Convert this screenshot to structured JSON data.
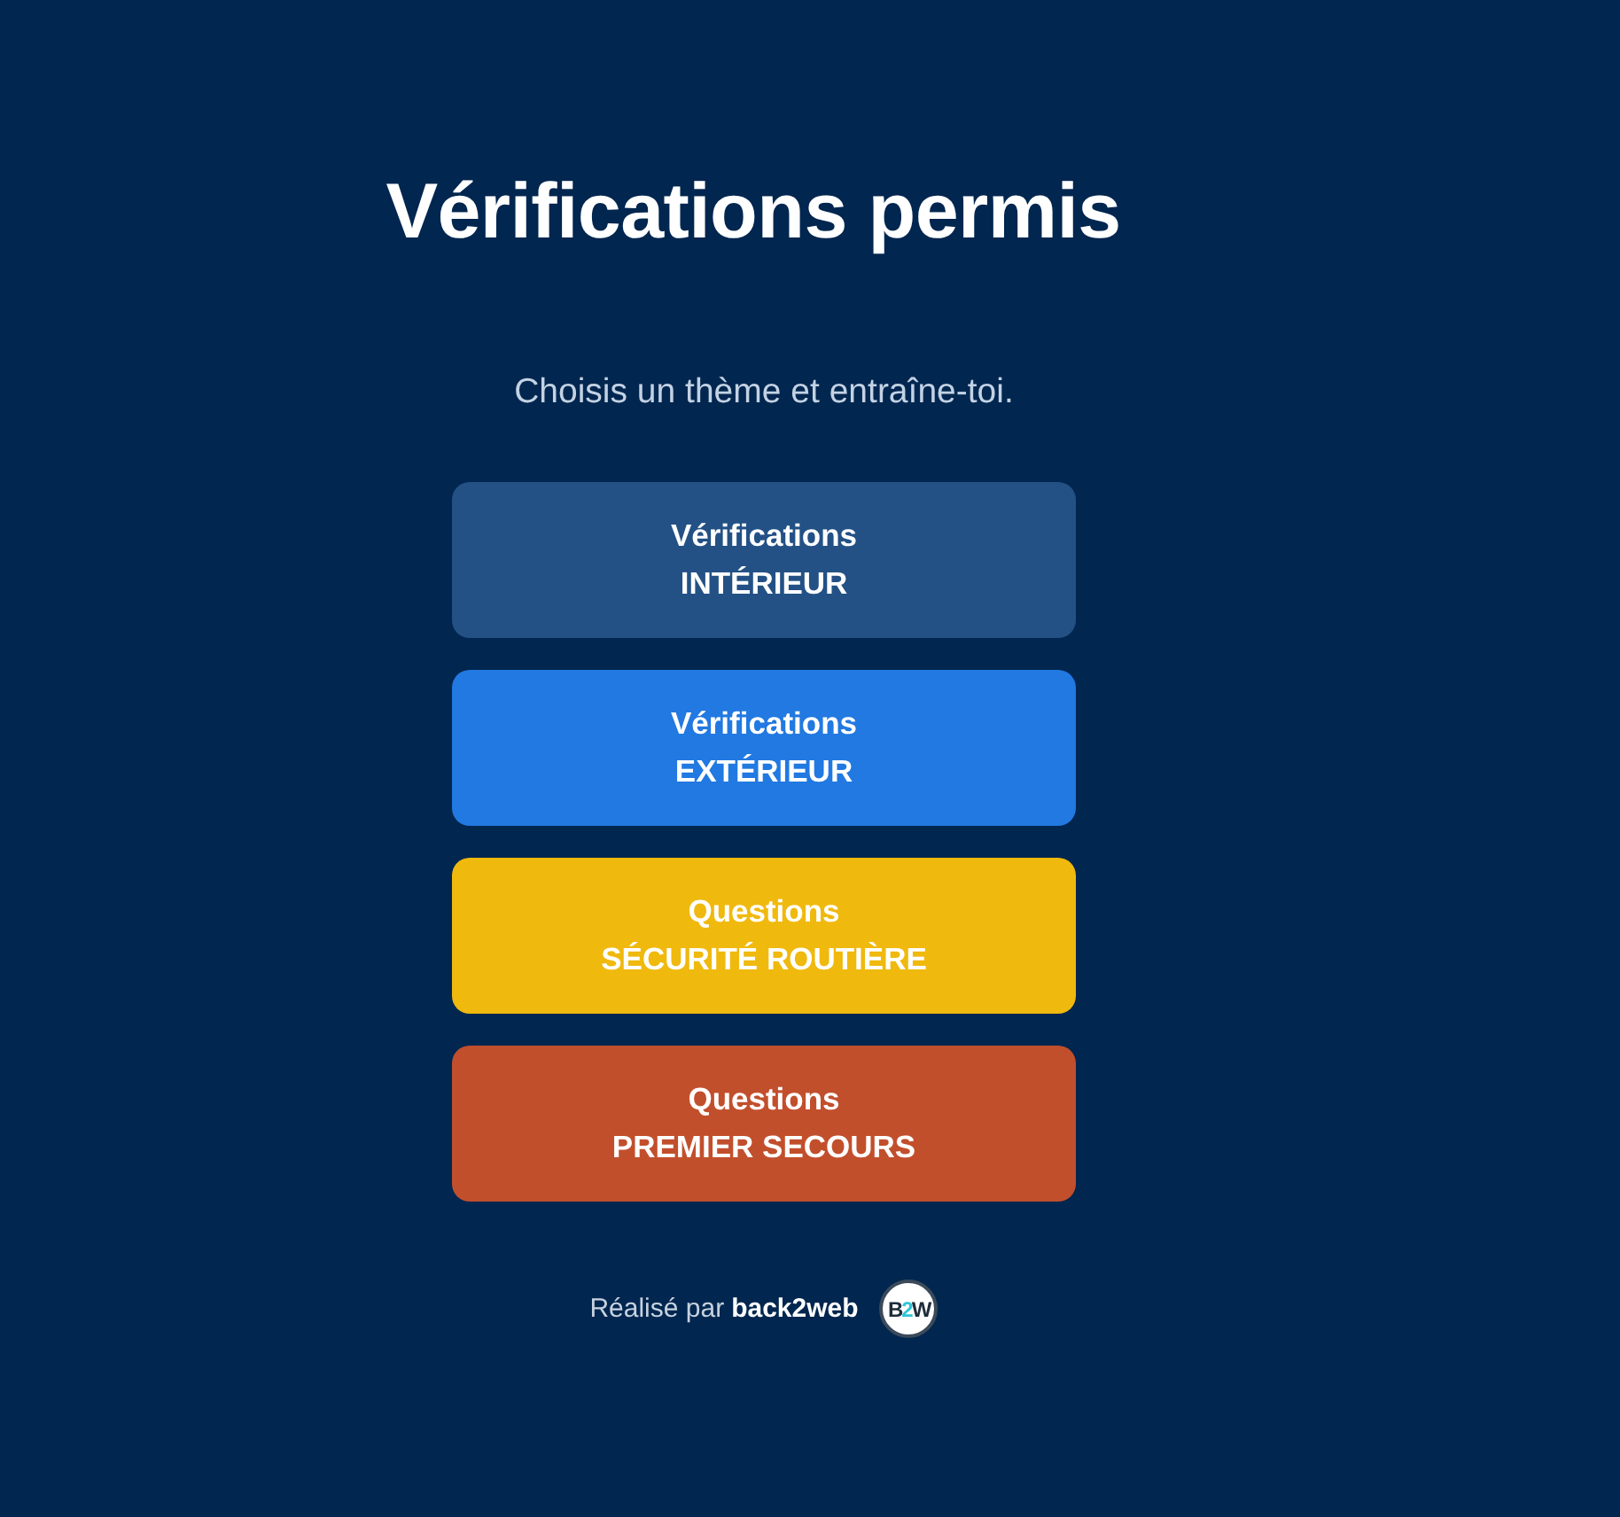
{
  "title": "Vérifications permis",
  "subtitle": "Choisis un thème et entraîne-toi.",
  "themes": [
    {
      "line1": "Vérifications",
      "line2": "INTÉRIEUR",
      "color": "#235185"
    },
    {
      "line1": "Vérifications",
      "line2": "EXTÉRIEUR",
      "color": "#2179e1"
    },
    {
      "line1": "Questions",
      "line2": "SÉCURITÉ ROUTIÈRE",
      "color": "#f0b90d"
    },
    {
      "line1": "Questions",
      "line2": "PREMIER SECOURS",
      "color": "#c24f2c"
    }
  ],
  "footer": {
    "credit": "Réalisé par",
    "author": "back2web",
    "logo": [
      {
        "text": "B",
        "accent": false
      },
      {
        "text": "2",
        "accent": true
      },
      {
        "text": "W",
        "accent": false
      }
    ]
  }
}
